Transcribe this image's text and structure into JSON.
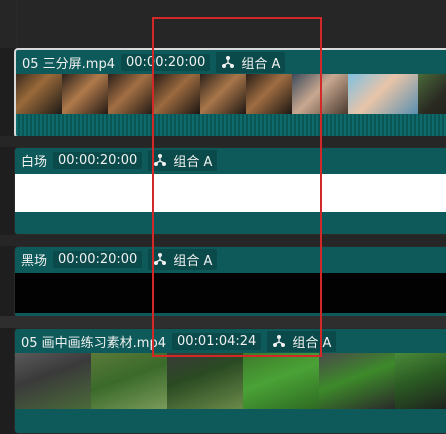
{
  "colors": {
    "clip_bg": "#0e5a5a",
    "tag_bg": "#0b4a4a",
    "selection": "#d32828",
    "timeline_bg": "#1e1e1e"
  },
  "clips": [
    {
      "name": "05 三分屏.mp4",
      "duration": "00:00:20:00",
      "group_icon": "merge-icon",
      "group": "组合 A"
    },
    {
      "name": "白场",
      "duration": "00:00:20:00",
      "group_icon": "merge-icon",
      "group": "组合 A"
    },
    {
      "name": "黑场",
      "duration": "00:00:20:00",
      "group_icon": "merge-icon",
      "group": "组合 A"
    },
    {
      "name": "05 画中画练习素材.mp4",
      "duration": "00:01:04:24",
      "group_icon": "merge-icon",
      "group": "组合 A"
    }
  ]
}
